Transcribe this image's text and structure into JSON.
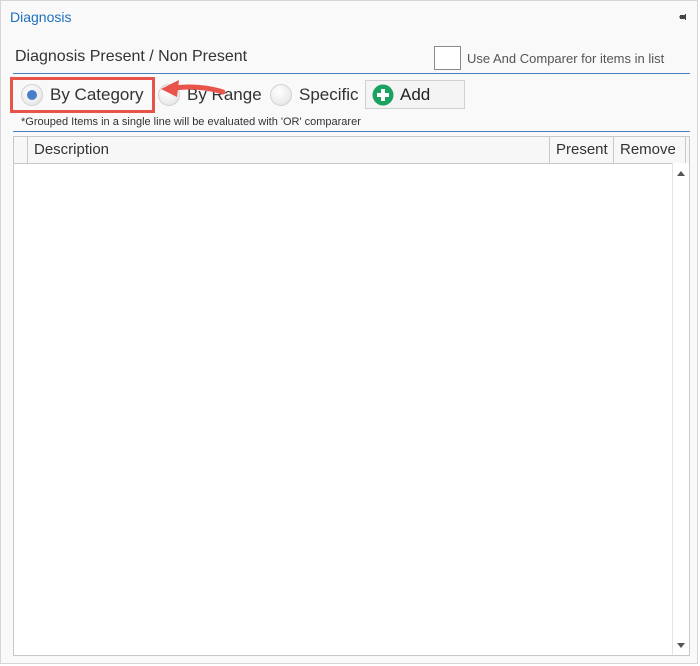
{
  "panel": {
    "title": "Diagnosis"
  },
  "section": {
    "title": "Diagnosis Present / Non Present"
  },
  "comparer": {
    "label": "Use And Comparer for items in list",
    "checked": false
  },
  "modes": {
    "items": [
      {
        "label": "By Category",
        "selected": true
      },
      {
        "label": "By Range",
        "selected": false
      },
      {
        "label": "Specific",
        "selected": false
      }
    ]
  },
  "add_button": {
    "label": "Add"
  },
  "note": "*Grouped Items in a single line will be evaluated with 'OR' compararer",
  "grid": {
    "columns": [
      "Description",
      "Present",
      "Remove"
    ],
    "rows": []
  },
  "colors": {
    "accent": "#1e6fbf",
    "highlight": "#e8534a",
    "radio_selected": "#4a7ec9",
    "add_icon": "#1aa260"
  }
}
